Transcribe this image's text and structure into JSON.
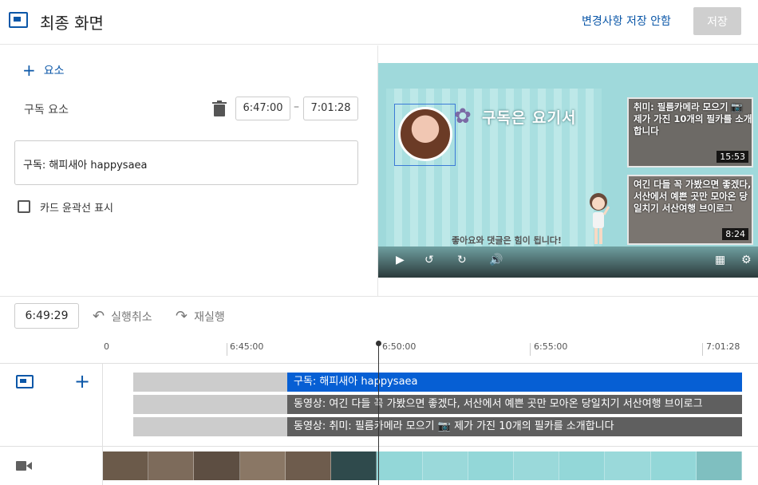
{
  "header": {
    "title": "최종 화면",
    "discard_label": "변경사항 저장 안함",
    "save_label": "저장"
  },
  "panel": {
    "add_element_label": "요소",
    "element_name": "구독 요소",
    "start_time": "6:47:00",
    "end_time": "7:01:28",
    "dash": "–",
    "text_value": "구독: 해피새아 happysaea",
    "card_outline_label": "카드 윤곽선 표시"
  },
  "preview": {
    "subscribe_text": "구독은 요기서",
    "like_text": "좋아요와 댓글은 힘이 됩니다!",
    "cards": [
      {
        "title": "취미: 필름카메라 모으기 📷 제가 가진 10개의 필카를 소개합니다",
        "duration": "15:53"
      },
      {
        "title": "여긴 다들 꼭 가봤으면 좋겠다, 서산에서 예쁜 곳만 모아온 당일치기 서산여행 브이로그",
        "duration": "8:24"
      }
    ]
  },
  "timeline": {
    "current_time": "6:49:29",
    "undo_label": "실행취소",
    "redo_label": "재실행",
    "ticks": [
      "0",
      "6:45:00",
      "6:50:00",
      "6:55:00",
      "7:01:28"
    ],
    "bars": [
      "구독: 해피새아 happysaea",
      "동영상: 여긴 다들 꼭 가봤으면 좋겠다, 서산에서 예쁜 곳만 모아온 당일치기 서산여행 브이로그",
      "동영상: 취미: 필름카메라 모으기 📷 제가 가진 10개의 필카를 소개합니다"
    ]
  },
  "colors": {
    "accent": "#065fd4",
    "link": "#0b57a8",
    "video_bg": "#9fd9db"
  }
}
